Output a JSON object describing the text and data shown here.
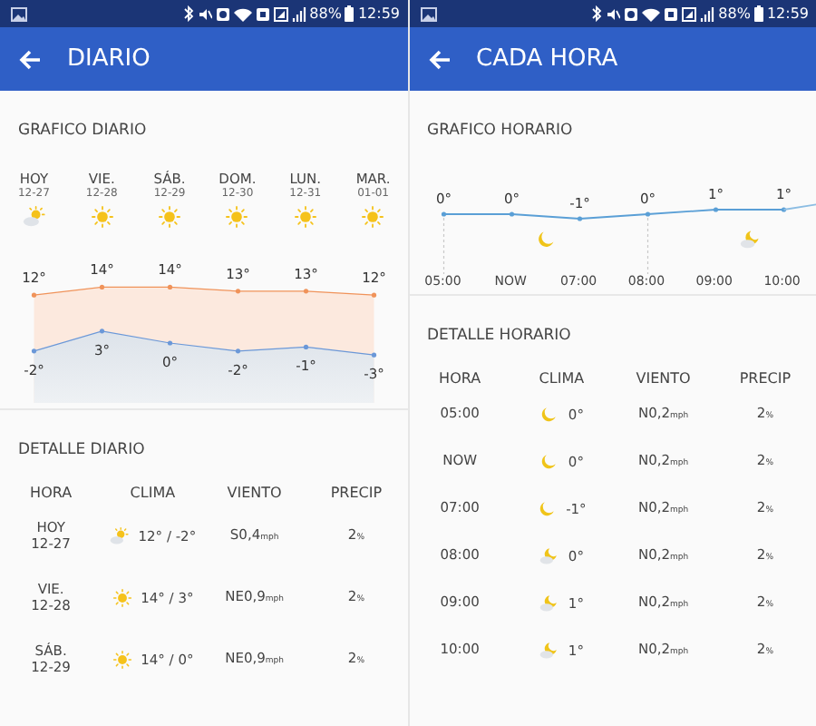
{
  "daily_screen": {
    "status_bar": {
      "battery": "88%",
      "time": "12:59"
    },
    "title": "DIARIO",
    "chart_title": "GRAFICO DIARIO",
    "chart_data": {
      "type": "area",
      "categories": [
        "HOY",
        "VIE.",
        "SÁB.",
        "DOM.",
        "LUN.",
        "MAR."
      ],
      "data_labels": true,
      "series": [
        {
          "type": "line",
          "color": "#f0935a",
          "values": [
            12,
            14,
            14,
            13,
            13,
            12
          ],
          "value_labels": [
            "12°",
            "14°",
            "14°",
            "13°",
            "13°",
            "12°"
          ]
        },
        {
          "type": "area",
          "color": "#6b98d8",
          "values": [
            -2,
            3,
            0,
            -2,
            -1,
            -3
          ],
          "value_labels": [
            "-2°",
            "3°",
            "0°",
            "-2°",
            "-1°",
            "-3°"
          ]
        }
      ]
    },
    "days": [
      {
        "date": "12-27",
        "kind": "sun-cloud"
      },
      {
        "date": "12-28",
        "kind": "sun"
      },
      {
        "date": "12-29",
        "kind": "sun"
      },
      {
        "date": "12-30",
        "kind": "sun"
      },
      {
        "date": "12-31",
        "kind": "sun"
      },
      {
        "date": "01-01",
        "kind": "sun"
      }
    ],
    "detail_title": "DETALLE DIARIO",
    "columns": [
      "HORA",
      "CLIMA",
      "VIENTO",
      "PRECIP"
    ],
    "rows": [
      {
        "hora": "HOY",
        "date": "12-27",
        "kind": "sun-cloud",
        "clima": "12° / -2°",
        "viento": "S0,4$_{mph}$",
        "precip": "2$_{%}$"
      },
      {
        "hora": "VIE.",
        "date": "12-28",
        "kind": "sun",
        "clima": "14° / 3°",
        "viento": "NE0,9$_{mph}$",
        "precip": "2$_{%}$"
      },
      {
        "hora": "SÁB.",
        "date": "12-29",
        "kind": "sun",
        "clima": "14° / 0°",
        "viento": "NE0,9$_{mph}$",
        "precip": "2$_{%}$"
      }
    ]
  },
  "hourly_screen": {
    "status_bar": {
      "battery": "88%",
      "time": "12:59"
    },
    "title": "CADA HORA",
    "chart_title": "GRAFICO HORARIO",
    "chart_data": {
      "type": "line",
      "categories": [
        "05:00",
        "NOW",
        "07:00",
        "08:00",
        "09:00",
        "10:00"
      ],
      "data_labels": true,
      "series": [
        {
          "color": "#5a9fd6",
          "values": [
            0,
            0,
            -1,
            0,
            1,
            1
          ],
          "value_labels": [
            "0°",
            "0°",
            "-1°",
            "0°",
            "1°",
            "1°"
          ]
        }
      ]
    },
    "detail_title": "DETALLE HORARIO",
    "columns": [
      "HORA",
      "CLIMA",
      "VIENTO",
      "PRECIP"
    ],
    "rows": [
      {
        "hora": "05:00",
        "kind": "moon",
        "clima": "0°",
        "viento": "N0,2$_{mph}$",
        "precip": "2$_{%}$"
      },
      {
        "hora": "NOW",
        "kind": "moon",
        "clima": "0°",
        "viento": "N0,2$_{mph}$",
        "precip": "2$_{%}$"
      },
      {
        "hora": "07:00",
        "kind": "moon",
        "clima": "-1°",
        "viento": "N0,2$_{mph}$",
        "precip": "2$_{%}$"
      },
      {
        "hora": "08:00",
        "kind": "moon-cloud",
        "clima": "0°",
        "viento": "N0,2$_{mph}$",
        "precip": "2$_{%}$"
      },
      {
        "hora": "09:00",
        "kind": "moon-cloud",
        "clima": "1°",
        "viento": "N0,2$_{mph}$",
        "precip": "2$_{%}$"
      },
      {
        "hora": "10:00",
        "kind": "moon-cloud",
        "clima": "1°",
        "viento": "N0,2$_{mph}$",
        "precip": "2$_{%}$"
      }
    ]
  }
}
